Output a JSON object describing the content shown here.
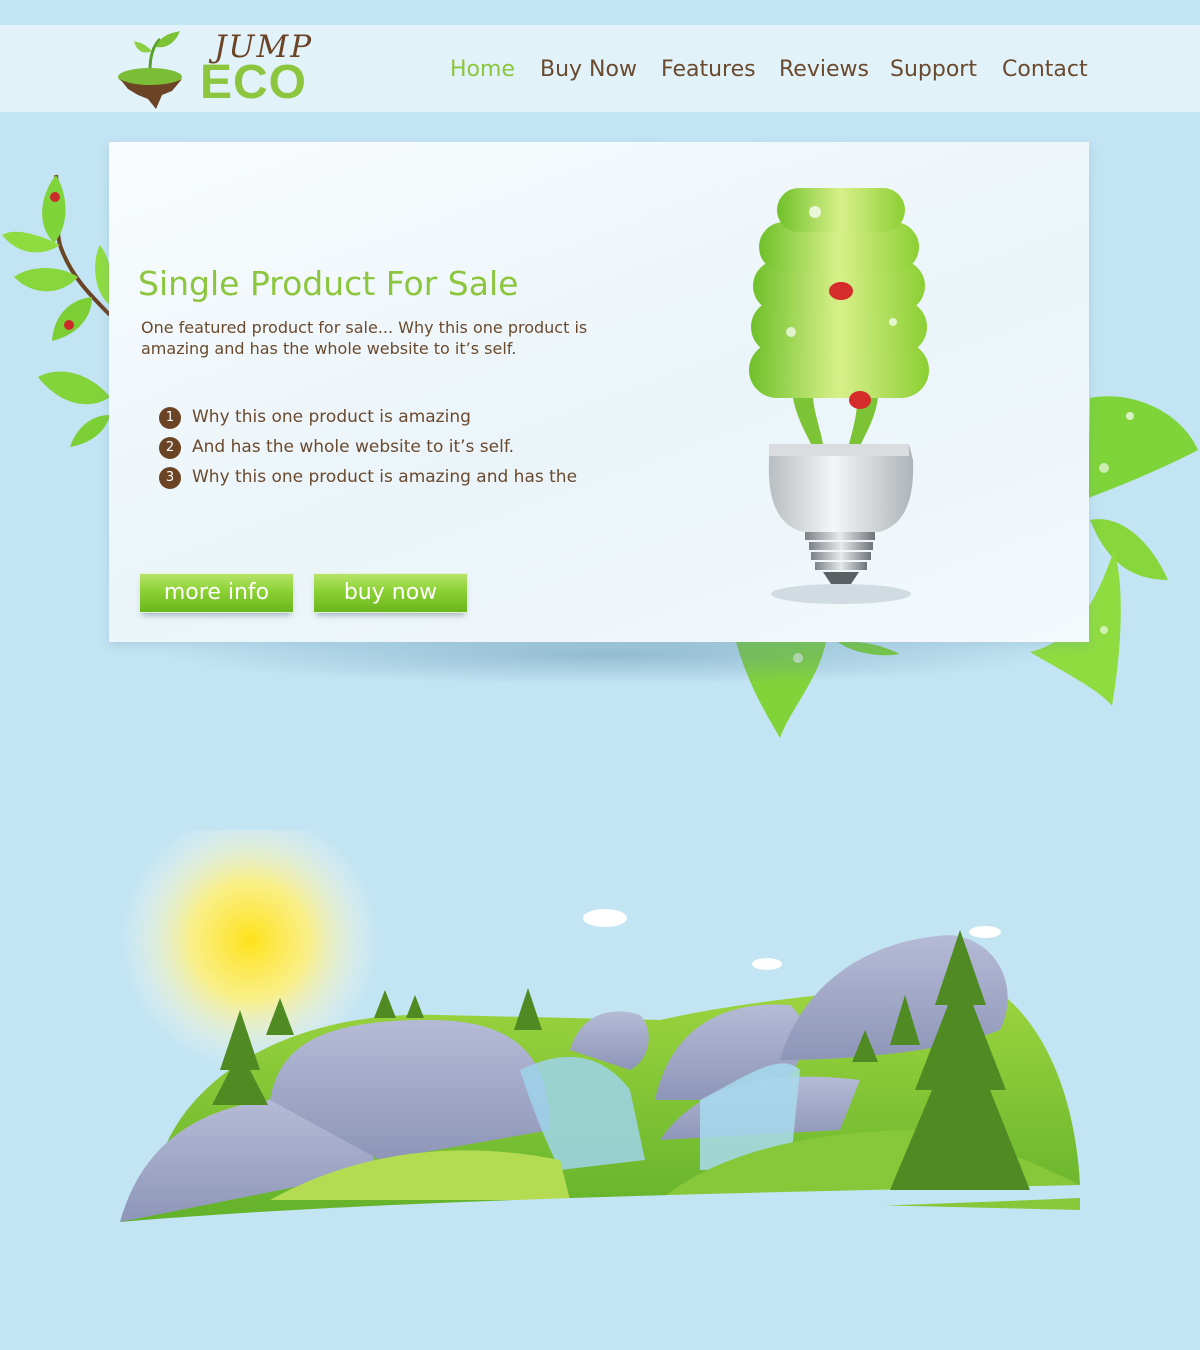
{
  "header": {
    "logo": {
      "top_word": "JUMP",
      "bottom_word": "ECO"
    },
    "nav": [
      {
        "label": "Home",
        "active": true
      },
      {
        "label": "Buy Now",
        "active": false
      },
      {
        "label": "Features",
        "active": false
      },
      {
        "label": "Reviews",
        "active": false
      },
      {
        "label": "Support",
        "active": false
      },
      {
        "label": "Contact",
        "active": false
      }
    ]
  },
  "hero": {
    "title": "Single Product For Sale",
    "description": "One featured product for sale...  Why this one product is amazing and has the whole website to it’s self.",
    "features": [
      {
        "number": "1",
        "text": "Why this one product is amazing"
      },
      {
        "number": "2",
        "text": "And has the whole website to it’s self."
      },
      {
        "number": "3",
        "text": "Why this one product is amazing and has the"
      }
    ],
    "buttons": {
      "more_info": "more info",
      "buy_now": "buy now"
    }
  },
  "colors": {
    "background": "#c3e4f3",
    "header_bar": "#e2f2f9",
    "accent_green": "#8cc63f",
    "text_brown": "#6a4a2e"
  },
  "icons": [
    "logo-sprout-icon",
    "eco-bulb-illustration",
    "leaf-branch-decoration",
    "landscape-illustration"
  ]
}
